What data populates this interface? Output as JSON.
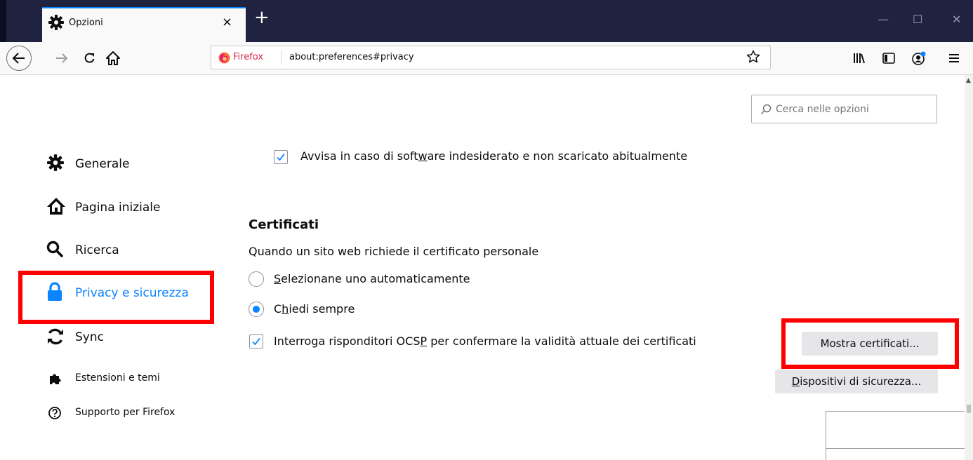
{
  "window": {
    "tab_title": "Opzioni",
    "tab_close": "×",
    "new_tab": "+",
    "minimize": "—",
    "maximize": "☐",
    "close": "✕"
  },
  "toolbar": {
    "identity": "Firefox",
    "url": "about:preferences#privacy"
  },
  "search": {
    "placeholder": "Cerca nelle opzioni"
  },
  "sidebar": {
    "items": [
      {
        "label": "Generale",
        "icon": "gear-icon"
      },
      {
        "label": "Pagina iniziale",
        "icon": "home-icon"
      },
      {
        "label": "Ricerca",
        "icon": "search-icon"
      },
      {
        "label": "Privacy e sicurezza",
        "icon": "lock-icon",
        "selected": true
      },
      {
        "label": "Sync",
        "icon": "sync-icon"
      },
      {
        "label": "Estensioni e temi",
        "icon": "puzzle-icon"
      },
      {
        "label": "Supporto per Firefox",
        "icon": "help-icon"
      }
    ]
  },
  "content": {
    "unwanted_software": {
      "pre": "Avvisa in caso di soft",
      "accesskey": "w",
      "post": "are indesiderato e non scaricato abitualmente",
      "checked": true
    },
    "certificates": {
      "heading": "Certificati",
      "description": "Quando un sito web richiede il certificato personale",
      "auto_select": {
        "accesskey": "S",
        "rest": "elezionane uno automaticamente",
        "checked": false
      },
      "ask_always": {
        "pre": "C",
        "accesskey": "h",
        "post": "iedi sempre",
        "checked": true
      },
      "ocsp": {
        "pre": "Interroga risponditori OCS",
        "accesskey": "P",
        "post": " per confermare la validità attuale dei certificati",
        "checked": true
      },
      "show_certificates_button": "Mostra certificati...",
      "security_devices_button": {
        "accesskey": "D",
        "rest": "ispositivi di sicurezza..."
      }
    }
  },
  "colors": {
    "accent": "#0a84ff",
    "highlight": "#ff0000",
    "titlebar": "#202340"
  }
}
